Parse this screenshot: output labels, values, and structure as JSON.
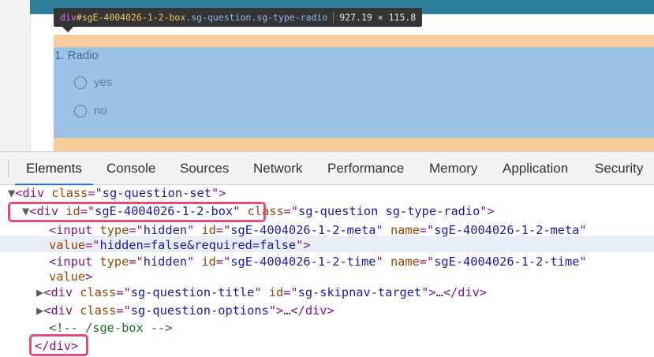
{
  "tooltip": {
    "tag": "div",
    "id": "#sgE-4004026-1-2-box",
    "classes": ".sg-question.sg-type-radio",
    "dimensions": "927.19 × 115.8"
  },
  "question": {
    "title": "1. Radio",
    "options": [
      {
        "label": "yes"
      },
      {
        "label": "no"
      }
    ]
  },
  "devtools": {
    "tabs": [
      "Elements",
      "Console",
      "Sources",
      "Network",
      "Performance",
      "Memory",
      "Application",
      "Security"
    ],
    "active_tab": "Elements",
    "dom": {
      "l1": {
        "tag": "div",
        "attr": "class",
        "val": "sg-question-set"
      },
      "l2": {
        "tag": "div",
        "attr1": "id",
        "val1": "sgE-4004026-1-2-box",
        "attr2": "class",
        "val2": "sg-question sg-type-radio"
      },
      "l3": {
        "tag": "input",
        "a1": "type",
        "v1": "hidden",
        "a2": "id",
        "v2": "sgE-4004026-1-2-meta",
        "a3": "name",
        "v3": "sgE-4004026-1-2-meta",
        "a4": "value",
        "v4": "hidden=false&required=false"
      },
      "l5": {
        "tag": "input",
        "a1": "type",
        "v1": "hidden",
        "a2": "id",
        "v2": "sgE-4004026-1-2-time",
        "a3": "name",
        "v3": "sgE-4004026-1-2-time",
        "a4": "value"
      },
      "l7": {
        "tag": "div",
        "a1": "class",
        "v1": "sg-question-title",
        "a2": "id",
        "v2": "sg-skipnav-target",
        "ellipsis": "…",
        "close": "/div"
      },
      "l8": {
        "tag": "div",
        "a1": "class",
        "v1": "sg-question-options",
        "ellipsis": "…",
        "close": "/div"
      },
      "comment": "<!-- /sge-box -->",
      "closing": "</div>"
    }
  }
}
